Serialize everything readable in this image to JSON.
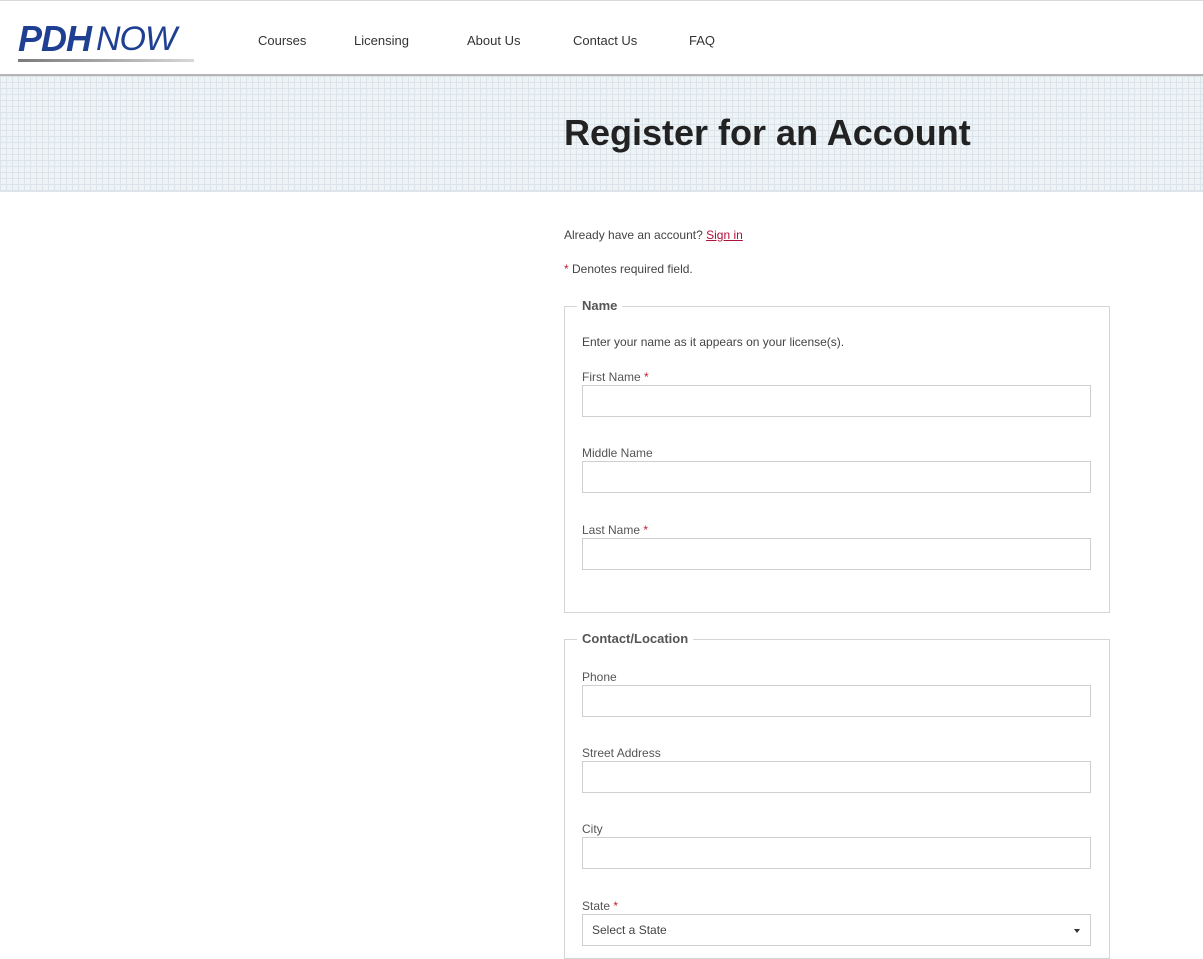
{
  "header": {
    "logo": {
      "main": "PDH",
      "sub": "NOW"
    },
    "nav": [
      "Courses",
      "Licensing",
      "About Us",
      "Contact Us",
      "FAQ"
    ]
  },
  "page": {
    "title": "Register for an Account",
    "already_text": "Already have an account?",
    "signin_label": "Sign in",
    "required_star": "*",
    "required_note": "Denotes required field."
  },
  "name_section": {
    "legend": "Name",
    "description": "Enter your name as it appears on your license(s).",
    "first_name_label": "First Name",
    "middle_name_label": "Middle Name",
    "last_name_label": "Last Name"
  },
  "contact_section": {
    "legend": "Contact/Location",
    "phone_label": "Phone",
    "street_label": "Street Address",
    "city_label": "City",
    "state_label": "State",
    "state_selected": "Select a State"
  },
  "colors": {
    "brand_blue": "#1e3f92",
    "required_red": "#c01f2f",
    "link_red": "#b0103c"
  }
}
